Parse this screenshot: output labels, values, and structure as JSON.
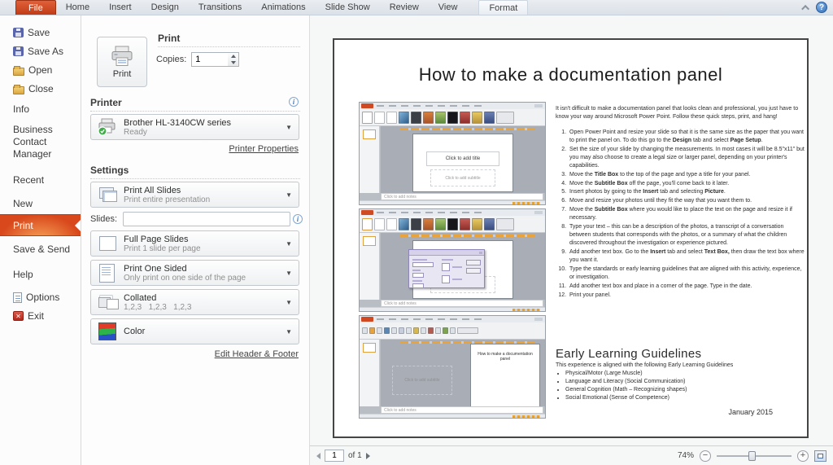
{
  "colors": {
    "accent_orange": "#D24726",
    "printer_ready_green": "#3FAE49",
    "help_blue": "#2F6DB8"
  },
  "icons": {
    "chevron_down": "▼",
    "help": "?",
    "info": "i",
    "exit_x": "✕",
    "minus": "−",
    "plus": "+"
  },
  "ribbon": {
    "tabs": [
      "File",
      "Home",
      "Insert",
      "Design",
      "Transitions",
      "Animations",
      "Slide Show",
      "Review",
      "View",
      "Format"
    ]
  },
  "sidebar": {
    "save": "Save",
    "save_as": "Save As",
    "open": "Open",
    "close": "Close",
    "info": "Info",
    "bcm": "Business Contact Manager",
    "recent": "Recent",
    "new": "New",
    "print": "Print",
    "save_send": "Save & Send",
    "help": "Help",
    "options": "Options",
    "exit": "Exit"
  },
  "print_panel": {
    "print_button": "Print",
    "print_header": "Print",
    "copies_label": "Copies:",
    "copies_value": "1",
    "printer_header": "Printer",
    "printer_name": "Brother HL-3140CW series",
    "printer_status": "Ready",
    "printer_properties": "Printer Properties",
    "settings_header": "Settings",
    "slides_label": "Slides:",
    "slides_value": "",
    "dropdowns": [
      {
        "title": "Print All Slides",
        "subtitle": "Print entire presentation"
      },
      {
        "title": "Full Page Slides",
        "subtitle": "Print 1 slide per page"
      },
      {
        "title": "Print One Sided",
        "subtitle": "Only print on one side of the page"
      },
      {
        "title": "Collated",
        "subtitle": "1,2,3   1,2,3   1,2,3"
      },
      {
        "title": "Color",
        "subtitle": ""
      }
    ],
    "edit_header_footer": "Edit Header & Footer"
  },
  "preview": {
    "title": "How to make a documentation panel",
    "intro": "It isn't difficult to make a documentation panel that looks clean and professional, you just have to know your way around Microsoft Power Point. Follow these quick steps, print, and hang!",
    "steps": [
      "Open Power Point and resize your slide so that it is the same size as the paper that you want to print the panel on. To do this go to the <b>Design</b> tab and select <b>Page Setup</b>.",
      "Set the size of your slide by changing the measurements.  In most cases it will be 8.5\"x11\" but you may also choose to create a legal size or larger panel, depending on your printer's capabilities.",
      "Move the <b>Title Box</b> to the top of the page and type a title for your panel.",
      "Move the <b>Subtitle Box</b> off the page, you'll come back to it later.",
      "Insert photos by going to the <b>Insert</b> tab and selecting <b>Picture</b>.",
      "Move and resize your photos until they fit the way that you want them to.",
      "Move the <b>Subtitle Box</b> where you would like to place the text on the page and resize it if necessary.",
      "Type your text – this can be a description of the photos, a transcript of a conversation between students that corresponds with the photos, or a summary of what the children discovered throughout the investigation or experience pictured.",
      "Add another text box.  Go to the <b>Insert</b> tab and select <b>Text Box,</b> then draw the text box where you want it.",
      "Type the standards or early learning guidelines that are aligned with this activity, experience, or investigation.",
      "Add another text box and place in a corner of the page.  Type in the date.",
      "Print your panel."
    ],
    "elg_title": "Early Learning Guidelines",
    "elg_intro": "This experience is aligned with the following Early Learning Guidelines",
    "elg_bullets": [
      "Physical/Motor (Large Muscle)",
      "Language and Literacy (Social Communication)",
      "General Cognition  (Math – Recognizing shapes)",
      "Social Emotional (Sense of Competence)"
    ],
    "date": "January 2015",
    "embedded": {
      "click_title": "Click to add title",
      "click_subtitle": "Click to add subtitle",
      "notes": "Click to add notes",
      "mini_title": "How to make a documentation panel"
    }
  },
  "statusbar": {
    "page_value": "1",
    "of_label": "of 1",
    "zoom_percent": "74%"
  }
}
